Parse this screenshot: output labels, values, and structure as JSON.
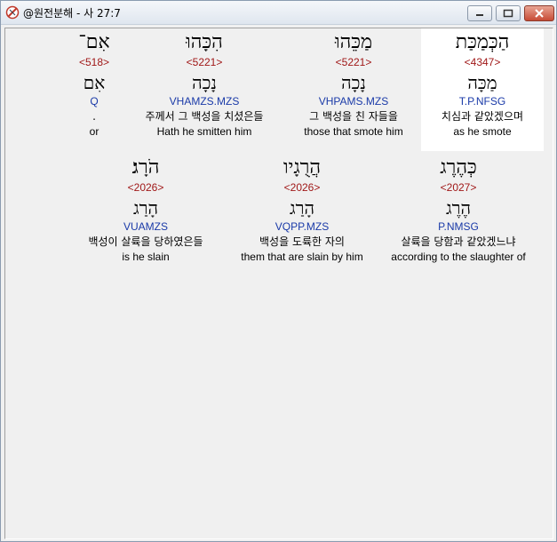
{
  "window": {
    "title": "@원전분해 - 사 27:7"
  },
  "rows": [
    {
      "words": [
        {
          "hebrew": "אִם־",
          "strong": "<518>",
          "lemma": "אִם",
          "morph": "Q",
          "korean": ".",
          "english": "or"
        },
        {
          "hebrew": "הִכָּהוּ",
          "strong": "<5221>",
          "lemma": "נָכָה",
          "morph": "VHAMZS.MZS",
          "korean": "주께서 그 백성을 치셨은들",
          "english": "Hath he smitten him"
        },
        {
          "hebrew": "מַכֵּהוּ",
          "strong": "<5221>",
          "lemma": "נָכָה",
          "morph": "VHPAMS.MZS",
          "korean": "그 백성을 친 자들을",
          "english": "those that smote him"
        },
        {
          "hebrew": "הַכְּמַכַּת",
          "strong": "<4347>",
          "lemma": "מַכָּה",
          "morph": "T.P.NFSG",
          "korean": "치심과 같았겠으며",
          "english": "as he smote"
        }
      ]
    },
    {
      "words": [
        {
          "hebrew": "הֹרָג׃",
          "strong": "<2026>",
          "lemma": "הָרַג",
          "morph": "VUAMZS",
          "korean": "백성이 살륙을 당하였은들",
          "english": "is he slain"
        },
        {
          "hebrew": "הֲרֻגָיו",
          "strong": "<2026>",
          "lemma": "הָרַג",
          "morph": "VQPP.MZS",
          "korean": "백성을 도륙한 자의",
          "english": "them that are slain by him"
        },
        {
          "hebrew": "כְּהֶרֶג",
          "strong": "<2027>",
          "lemma": "הֶרֶג",
          "morph": "P.NMSG",
          "korean": "살륙을 당함과 같았겠느냐",
          "english": "according to the slaughter of"
        }
      ]
    }
  ]
}
